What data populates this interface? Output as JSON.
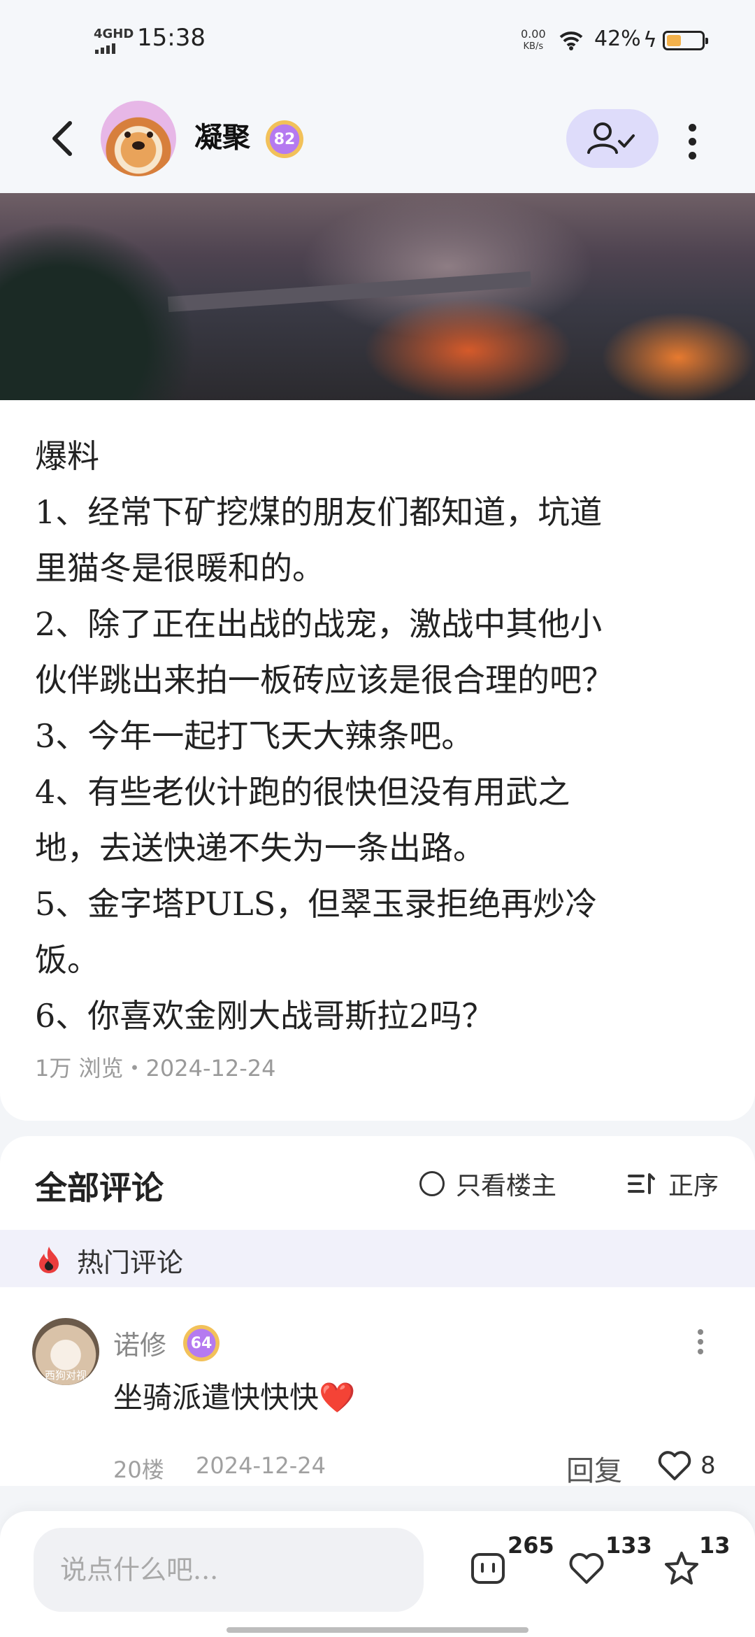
{
  "status_bar": {
    "network": "4GHD",
    "time": "15:38",
    "speed_value": "0.00",
    "speed_unit": "KB/s",
    "battery_percent": "42%",
    "battery_level": 0.42
  },
  "header": {
    "username": "凝聚",
    "level": "82",
    "icons": [
      "back-icon",
      "follow-user-icon",
      "more-vertical-icon"
    ]
  },
  "post": {
    "lines": [
      "爆料",
      "1、经常下矿挖煤的朋友们都知道，坑道",
      "里猫冬是很暖和的。",
      "2、除了正在出战的战宠，激战中其他小",
      "伙伴跳出来拍一板砖应该是很合理的吧？",
      "3、今年一起打飞天大辣条吧。",
      "4、有些老伙计跑的很快但没有用武之",
      "地，去送快递不失为一条出路。",
      "5、金字塔PULS，但翠玉录拒绝再炒冷",
      "饭。",
      "6、你喜欢金刚大战哥斯拉2吗？"
    ],
    "meta": "1万 浏览・2024-12-24"
  },
  "comments": {
    "title": "全部评论",
    "only_owner": "只看楼主",
    "sort": "正序",
    "hot_label": "热门评论",
    "items": [
      {
        "avatar_caption": "西狗对视",
        "name": "诺修",
        "level": "64",
        "text": "坐骑派遣快快快",
        "emoji": "❤️",
        "floor": "20楼",
        "date": "2024-12-24",
        "reply": "回复",
        "likes": "8"
      }
    ]
  },
  "bottom_bar": {
    "placeholder": "说点什么吧...",
    "comment_count": "265",
    "like_count": "133",
    "favorite_count": "13"
  }
}
